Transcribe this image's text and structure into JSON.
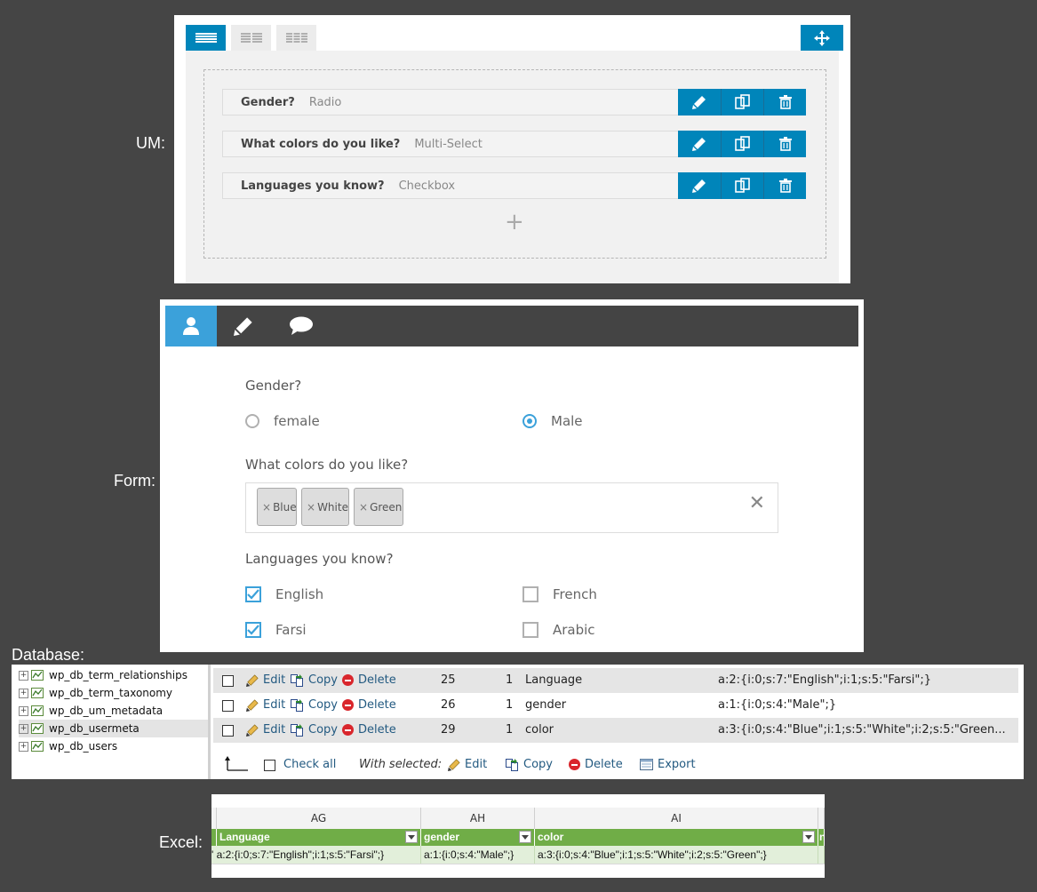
{
  "labels": {
    "um": "UM:",
    "form": "Form:",
    "database": "Database:",
    "excel": "Excel:"
  },
  "um": {
    "rows": [
      {
        "title": "Gender?",
        "type": "Radio"
      },
      {
        "title": "What colors do you like?",
        "type": "Multi-Select"
      },
      {
        "title": "Languages you know?",
        "type": "Checkbox"
      }
    ],
    "add_label": "+"
  },
  "form": {
    "q1": {
      "label": "Gender?",
      "options": [
        "female",
        "Male"
      ],
      "selected": "Male"
    },
    "q2": {
      "label": "What colors do you like?",
      "chips": [
        "Blue",
        "White",
        "Green"
      ],
      "chip_remove": "×",
      "clear": "✕"
    },
    "q3": {
      "label": "Languages you know?",
      "options": [
        {
          "label": "English",
          "checked": true
        },
        {
          "label": "French",
          "checked": false
        },
        {
          "label": "Farsi",
          "checked": true
        },
        {
          "label": "Arabic",
          "checked": false
        }
      ]
    }
  },
  "database": {
    "tables": [
      "wp_db_term_relationships",
      "wp_db_term_taxonomy",
      "wp_db_um_metadata",
      "wp_db_usermeta",
      "wp_db_users"
    ],
    "selected_table": "wp_db_usermeta",
    "actions": {
      "edit": "Edit",
      "copy": "Copy",
      "delete": "Delete"
    },
    "rows": [
      {
        "id": "25",
        "user": "1",
        "key": "Language",
        "value": "a:2:{i:0;s:7:\"English\";i:1;s:5:\"Farsi\";}"
      },
      {
        "id": "26",
        "user": "1",
        "key": "gender",
        "value": "a:1:{i:0;s:4:\"Male\";}"
      },
      {
        "id": "29",
        "user": "1",
        "key": "color",
        "value": "a:3:{i:0;s:4:\"Blue\";i:1;s:5:\"White\";i:2;s:5:\"Green..."
      }
    ],
    "footer": {
      "check_all": "Check all",
      "with_selected": "With selected:",
      "edit": "Edit",
      "copy": "Copy",
      "delete": "Delete",
      "export": "Export"
    }
  },
  "excel": {
    "columns": [
      "AG",
      "AH",
      "AI"
    ],
    "headers": [
      "Language",
      "gender",
      "color"
    ],
    "values": [
      "' a:2:{i:0;s:7:\"English\";i:1;s:5:\"Farsi\";}",
      "a:1:{i:0;s:4:\"Male\";}",
      "a:3:{i:0;s:4:\"Blue\";i:1;s:5:\"White\";i:2;s:5:\"Green\";}"
    ],
    "overflow_header": "n"
  },
  "colors": {
    "um_blue": "#0085ba",
    "form_accent": "#3ba1da",
    "excel_green": "#70ad47"
  }
}
